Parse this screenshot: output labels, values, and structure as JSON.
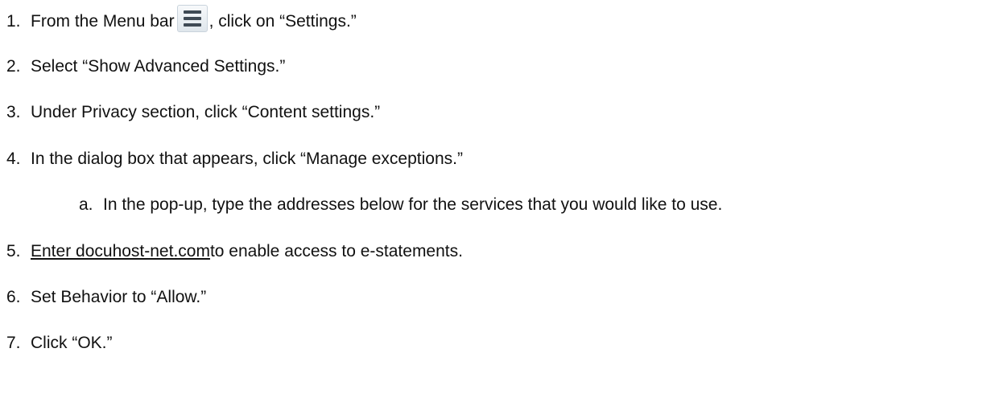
{
  "steps": [
    {
      "num": "1.",
      "before": "From the Menu bar",
      "icon": "hamburger-menu-icon",
      "after": ", click on “Settings.”"
    },
    {
      "num": "2.",
      "text": "Select “Show Advanced Settings.”"
    },
    {
      "num": "3.",
      "text": "Under Privacy section, click “Content settings.”"
    },
    {
      "num": "4.",
      "text": "In the dialog box that appears, click “Manage exceptions.”"
    },
    {
      "num": "a.",
      "text": "In the pop-up, type the addresses below for the services that you would like to use."
    },
    {
      "num": "5.",
      "link": "Enter docuhost-net.com",
      "after": " to enable access to e-statements."
    },
    {
      "num": "6.",
      "text": "Set Behavior to “Allow.”"
    },
    {
      "num": "7.",
      "text": "Click “OK.”"
    }
  ]
}
